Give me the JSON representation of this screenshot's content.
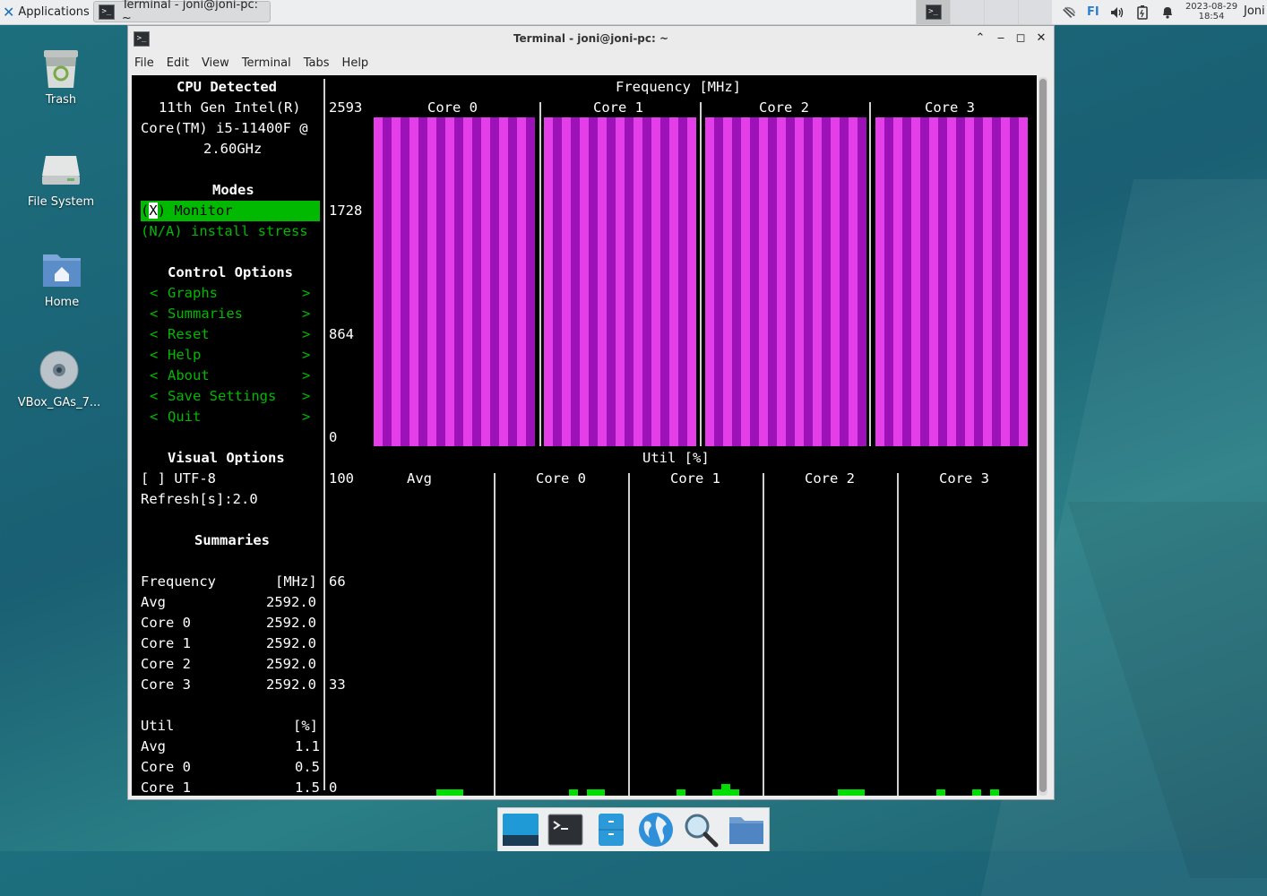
{
  "top_panel": {
    "applications_label": "Applications",
    "task_title": "Terminal - joni@joni-pc: ~",
    "keyboard_layout": "FI",
    "clock_date": "2023-08-29",
    "clock_time": "18:54",
    "user": "Joni"
  },
  "desktop": {
    "trash": "Trash",
    "file_system": "File System",
    "home": "Home",
    "vbox": "VBox_GAs_7..."
  },
  "window": {
    "title": "Terminal - joni@joni-pc: ~",
    "menu": [
      "File",
      "Edit",
      "View",
      "Terminal",
      "Tabs",
      "Help"
    ]
  },
  "sidebar": {
    "cpu_title": "CPU Detected",
    "cpu_line1": "11th Gen Intel(R)",
    "cpu_line2": "Core(TM) i5-11400F @",
    "cpu_line3": "2.60GHz",
    "modes_title": "Modes",
    "mode_monitor_prefix": "(",
    "mode_monitor_cursor": "X",
    "mode_monitor_rest": ") Monitor",
    "mode_stress": "(N/A) install stress",
    "control_title": "Control Options",
    "controls": [
      {
        "left": "<",
        "label": "Graphs",
        "right": ">"
      },
      {
        "left": "<",
        "label": "Summaries",
        "right": ">"
      },
      {
        "left": "<",
        "label": "Reset",
        "right": ">"
      },
      {
        "left": "<",
        "label": "Help",
        "right": ">"
      },
      {
        "left": "<",
        "label": "About",
        "right": ">"
      },
      {
        "left": "<",
        "label": "Save Settings",
        "right": ">"
      },
      {
        "left": "<",
        "label": "Quit",
        "right": ">"
      }
    ],
    "visual_title": "Visual Options",
    "utf8_checkbox": "[ ] UTF-8",
    "refresh": "Refresh[s]:2.0",
    "summaries_title": "Summaries",
    "freq_header_label": "Frequency",
    "freq_header_unit": "[MHz]",
    "freq_rows": [
      {
        "label": "Avg",
        "value": "2592.0"
      },
      {
        "label": "Core 0",
        "value": "2592.0"
      },
      {
        "label": "Core 1",
        "value": "2592.0"
      },
      {
        "label": "Core 2",
        "value": "2592.0"
      },
      {
        "label": "Core 3",
        "value": "2592.0"
      }
    ],
    "util_header_label": "Util",
    "util_header_unit": "[%]",
    "util_rows": [
      {
        "label": "Avg",
        "value": "1.1"
      },
      {
        "label": "Core 0",
        "value": "0.5"
      },
      {
        "label": "Core 1",
        "value": "1.5"
      }
    ]
  },
  "chart_data": [
    {
      "type": "bar",
      "title": "Frequency [MHz]",
      "categories": [
        "Core 0",
        "Core 1",
        "Core 2",
        "Core 3"
      ],
      "values": [
        2592,
        2592,
        2592,
        2592
      ],
      "ylim": [
        0,
        2593
      ],
      "yticks": [
        "2593",
        "1728",
        "864",
        "0"
      ],
      "colors": {
        "light": "#e43ee8",
        "dark": "#9c12b8"
      }
    },
    {
      "type": "bar",
      "title": "Util [%]",
      "categories": [
        "Avg",
        "Core 0",
        "Core 1",
        "Core 2",
        "Core 3"
      ],
      "values": [
        1.1,
        0.5,
        1.5,
        1.0,
        1.0
      ],
      "ylim": [
        0,
        100
      ],
      "yticks": [
        "100",
        "66",
        "33",
        "0"
      ],
      "colors": {
        "bar": "#00dd00"
      }
    }
  ]
}
